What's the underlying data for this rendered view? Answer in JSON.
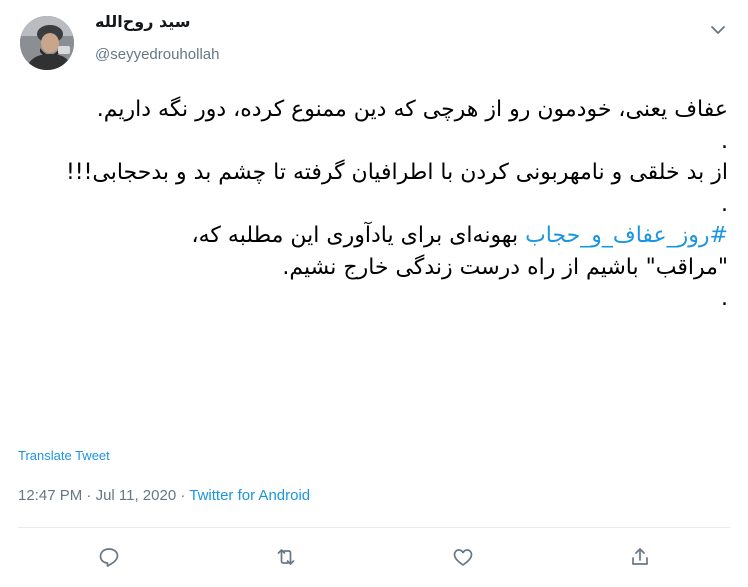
{
  "user": {
    "display_name": "سید روح‌الله",
    "handle": "@seyyedrouhollah"
  },
  "tweet": {
    "lines": [
      "عفاف یعنی، خودمون رو از هرچی که دین ممنوع کرده، دور نگه داریم.",
      ".",
      "از بد خلقی و نامهربونی کردن با اطرافیان گرفته تا چشم بد و بدحجابی!!!",
      "."
    ],
    "hashtag": "#روز_عفاف_و_حجاب",
    "hashtag_rest": " بهونه‌ای برای یادآوری این مطلبه که،",
    "line_after": "\"مراقب\" باشیم از راه درست زندگی خارج نشیم.",
    "line_last": "."
  },
  "translate_label": "Translate Tweet",
  "meta": {
    "time": "12:47 PM",
    "sep1": " · ",
    "date": "Jul 11, 2020",
    "sep2": " · ",
    "source": "Twitter for Android"
  },
  "icons": {
    "more": "chevron-down-icon",
    "reply": "reply-icon",
    "retweet": "retweet-icon",
    "like": "like-icon",
    "share": "share-icon"
  },
  "colors": {
    "link": "#1b95e0",
    "secondary": "#657786",
    "icon": "#657786"
  }
}
